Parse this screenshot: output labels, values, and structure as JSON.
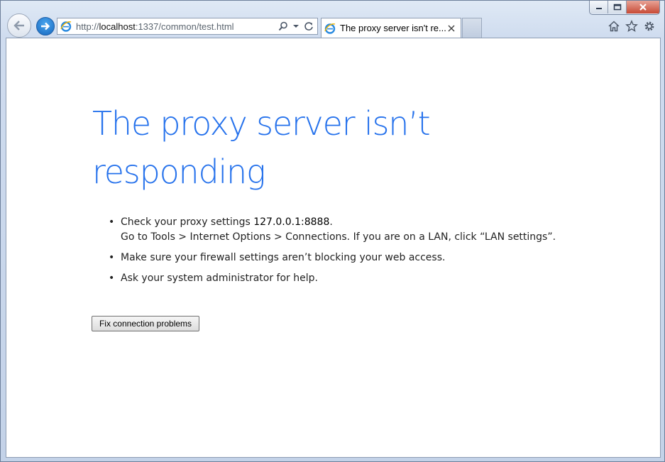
{
  "browser": {
    "address": {
      "scheme": "http://",
      "host": "localhost",
      "rest": ":1337/common/test.html"
    },
    "tab": {
      "title": "The proxy server isn't re..."
    },
    "icons": {
      "back": "back-arrow-icon",
      "forward": "forward-arrow-icon",
      "page": "ie-logo-icon",
      "search": "search-icon",
      "dropdown": "dropdown-arrow-icon",
      "refresh": "refresh-icon",
      "close_tab": "close-icon",
      "home": "home-icon",
      "favorites": "star-icon",
      "tools": "gear-icon",
      "minimize": "minimize-icon",
      "restore": "restore-icon",
      "close_window": "close-icon"
    },
    "colors": {
      "accent": "#2672ec",
      "forward_button": "#1667bf",
      "close_button": "#c74a35"
    }
  },
  "page": {
    "heading": "The proxy server isn’t responding",
    "bullets": {
      "b1_prefix": "Check your proxy settings ",
      "b1_proxy": "127.0.0.1:8888",
      "b1_suffix": ".",
      "b1_line2": "Go to Tools > Internet Options > Connections. If you are on a LAN, click “LAN settings”.",
      "b2": "Make sure your firewall settings aren’t blocking your web access.",
      "b3": "Ask your system administrator for help.",
      "dot": "•"
    },
    "fix_button": "Fix connection problems"
  }
}
